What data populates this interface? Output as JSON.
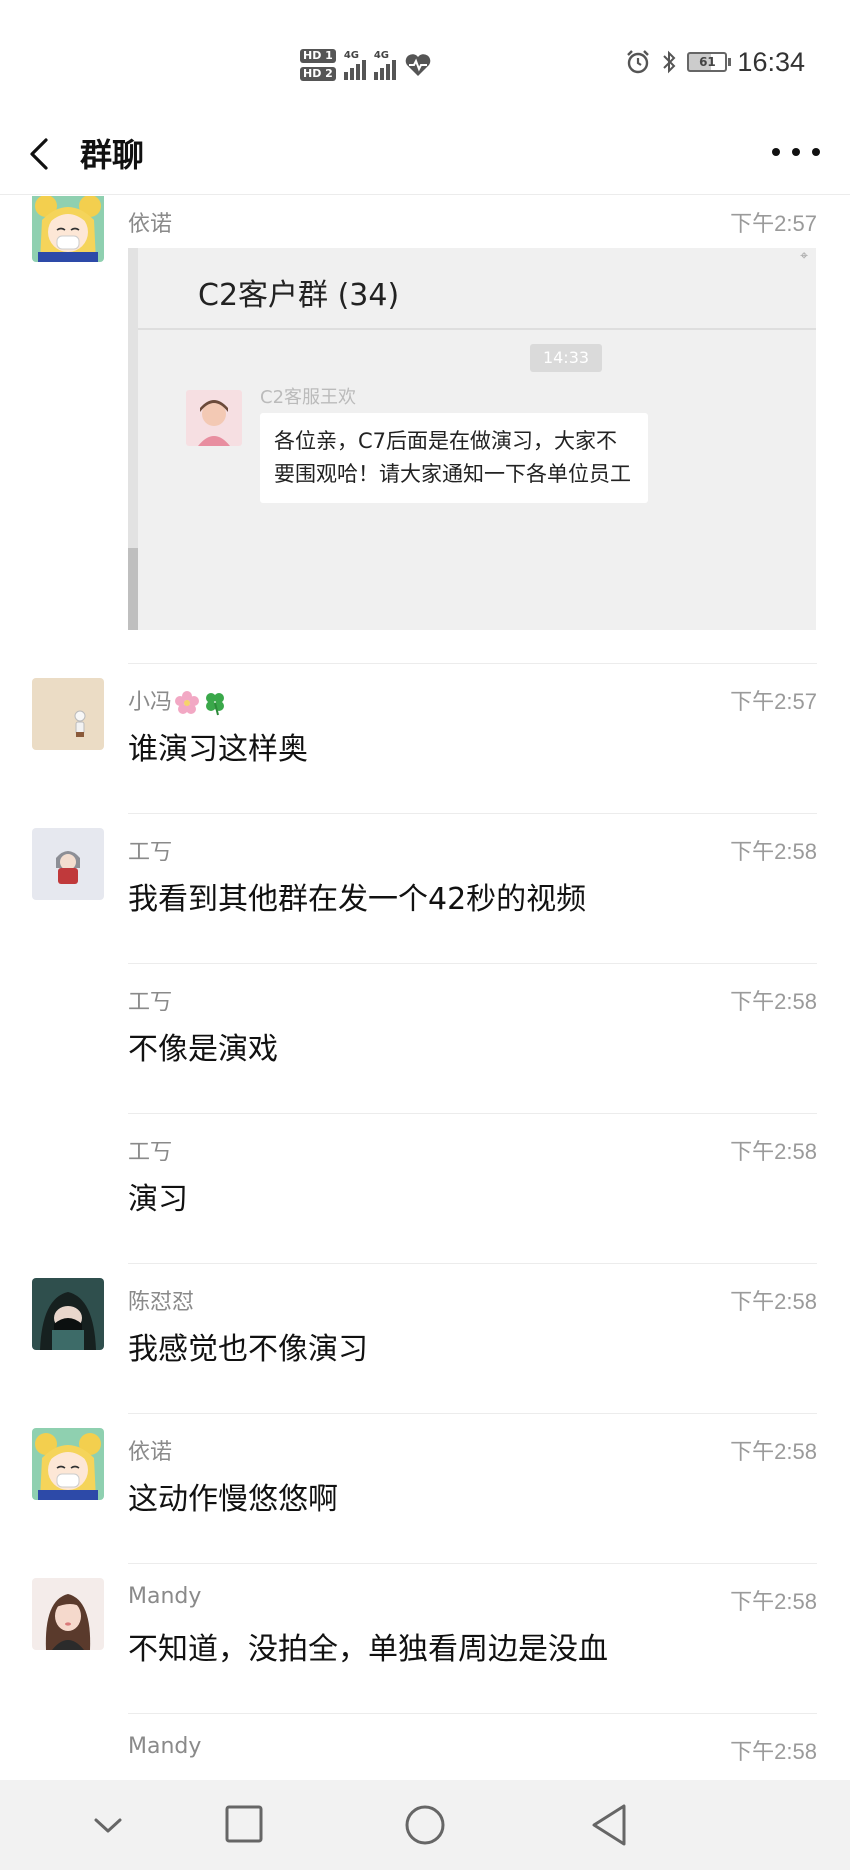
{
  "status_bar": {
    "hd_badges": [
      "HD 1",
      "HD 2"
    ],
    "network_labels": [
      "4G",
      "4G"
    ],
    "icons": [
      "signal-icon",
      "heartbeat-icon",
      "alarm-icon",
      "bluetooth-icon",
      "battery-icon"
    ],
    "battery_level": "61",
    "time": "16:34"
  },
  "header": {
    "back_icon": "chevron-left-icon",
    "title": "群聊",
    "more_icon": "more-dots-icon"
  },
  "messages": [
    {
      "sender": "依诺",
      "time": "下午2:57",
      "avatar": "sailor-moon-avatar",
      "type": "screenshot",
      "screenshot": {
        "group_title": "C2客户群 (34)",
        "time": "14:33",
        "sender": "C2客服王欢",
        "text": "各位亲，C7后面是在做演习，大家不要围观哈！请大家通知一下各单位员工"
      }
    },
    {
      "sender": "小冯",
      "emojis": [
        "flower-emoji",
        "clover-emoji"
      ],
      "time": "下午2:57",
      "avatar": "beige-figure-avatar",
      "text": "谁演习这样奥"
    },
    {
      "sender": "工丂",
      "time": "下午2:58",
      "avatar": "red-figure-avatar",
      "text": "我看到其他群在发一个42秒的视频"
    },
    {
      "sender": "工丂",
      "time": "下午2:58",
      "avatar": "",
      "text": "不像是演戏"
    },
    {
      "sender": "工丂",
      "time": "下午2:58",
      "avatar": "",
      "text": "演习"
    },
    {
      "sender": "陈怼怼",
      "time": "下午2:58",
      "avatar": "dark-hood-avatar",
      "text": "我感觉也不像演习"
    },
    {
      "sender": "依诺",
      "time": "下午2:58",
      "avatar": "sailor-moon-avatar",
      "text": "这动作慢悠悠啊"
    },
    {
      "sender": "Mandy",
      "time": "下午2:58",
      "avatar": "girl-portrait-avatar",
      "text": "不知道，没拍全，单独看周边是没血"
    },
    {
      "sender": "Mandy",
      "time": "下午2:58",
      "avatar": "",
      "text": ""
    }
  ],
  "nav_bar": {
    "buttons": [
      "collapse-chevron-icon",
      "recents-square-icon",
      "home-circle-icon",
      "back-triangle-icon"
    ]
  }
}
